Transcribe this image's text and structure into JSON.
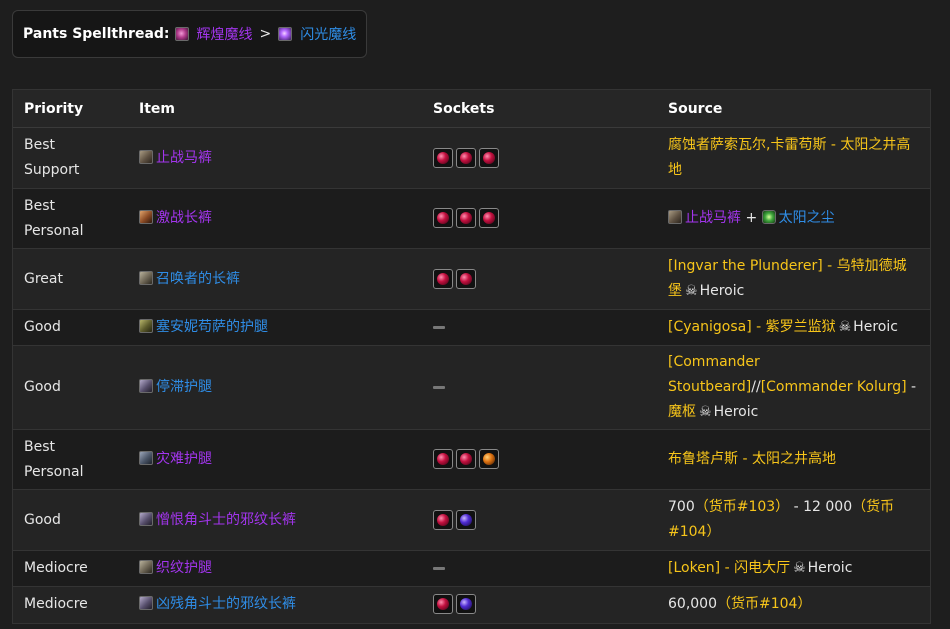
{
  "spellthread": {
    "label": "Pants Spellthread:",
    "from": "辉煌魔线",
    "separator": ">",
    "to": "闪光魔线"
  },
  "table": {
    "headers": [
      "Priority",
      "Item",
      "Sockets",
      "Source"
    ],
    "rows": [
      {
        "priority": "Best Support",
        "item": "止战马裤",
        "sockets": [
          "red",
          "red",
          "red"
        ],
        "source_parts": [
          {
            "text": "腐蚀者萨索瓦尔,卡雷苟斯 - 太阳之井高地",
            "color": "gold"
          }
        ]
      },
      {
        "priority": "Best Personal",
        "item": "激战长裤",
        "sockets": [
          "red",
          "red",
          "red"
        ],
        "source_parts": [
          {
            "text": "止战马裤",
            "color": "purple",
            "icon": "item"
          },
          {
            "text": " + ",
            "color": "white"
          },
          {
            "text": "太阳之尘",
            "color": "blue",
            "icon": "dust"
          }
        ]
      },
      {
        "priority": "Great",
        "item": "召唤者的长裤",
        "sockets": [
          "red",
          "red"
        ],
        "source_parts": [
          {
            "text": "[Ingvar the Plunderer] - 乌特加德城堡",
            "color": "gold"
          },
          {
            "text": "Heroic",
            "color": "white",
            "skull": true
          }
        ]
      },
      {
        "priority": "Good",
        "item": "塞安妮苟萨的护腿",
        "sockets": [],
        "source_parts": [
          {
            "text": "[Cyanigosa] - 紫罗兰监狱",
            "color": "gold"
          },
          {
            "text": "Heroic",
            "color": "white",
            "skull": true
          }
        ]
      },
      {
        "priority": "Good",
        "item": "停滞护腿",
        "sockets": [],
        "source_parts": [
          {
            "text": "[Commander Stoutbeard]",
            "color": "gold"
          },
          {
            "text": "//",
            "color": "white"
          },
          {
            "text": "[Commander Kolurg]",
            "color": "gold"
          },
          {
            "text": " - ",
            "color": "white"
          },
          {
            "text": "魔枢",
            "color": "gold"
          },
          {
            "text": "Heroic",
            "color": "white",
            "skull": true
          }
        ]
      },
      {
        "priority": "Best Personal",
        "item": "灾难护腿",
        "sockets": [
          "red",
          "red",
          "orange"
        ],
        "source_parts": [
          {
            "text": "布鲁塔卢斯 - 太阳之井高地",
            "color": "gold"
          }
        ]
      },
      {
        "priority": "Good",
        "item": "憎恨角斗士的邪纹长裤",
        "sockets": [
          "red",
          "blue"
        ],
        "source_parts": [
          {
            "text": "700",
            "color": "white"
          },
          {
            "text": "（货币#103）",
            "color": "gold"
          },
          {
            "text": " - 12 000",
            "color": "white"
          },
          {
            "text": "（货币#104）",
            "color": "gold"
          }
        ]
      },
      {
        "priority": "Mediocre",
        "item": "织纹护腿",
        "sockets": [],
        "source_parts": [
          {
            "text": "[Loken] - 闪电大厅",
            "color": "gold"
          },
          {
            "text": "Heroic",
            "color": "white",
            "skull": true
          }
        ]
      },
      {
        "priority": "Mediocre",
        "item": "凶残角斗士的邪纹长裤",
        "sockets": [
          "red",
          "blue"
        ],
        "source_parts": [
          {
            "text": "60,000",
            "color": "white"
          },
          {
            "text": "（货币#104）",
            "color": "gold"
          }
        ]
      }
    ]
  },
  "colors": {
    "epic": "#a335ee",
    "rare": "#2f8de6",
    "source_gold": "#f7c51a",
    "background": "#1e1e1e"
  }
}
